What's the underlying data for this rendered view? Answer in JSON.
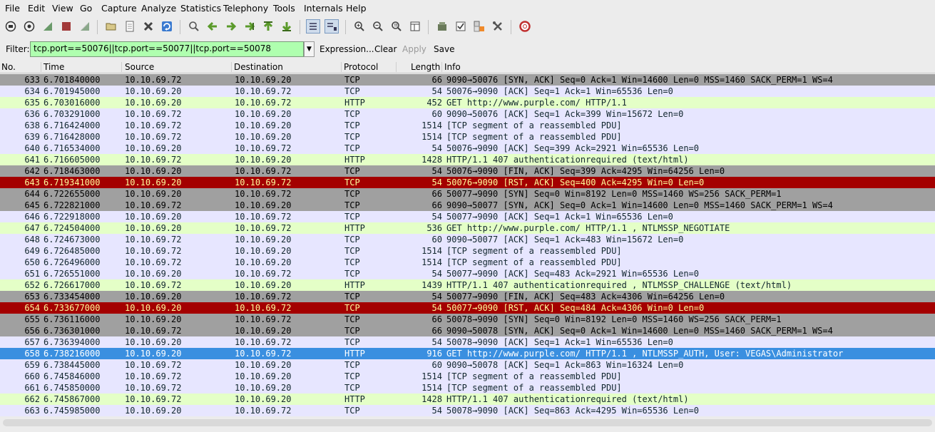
{
  "menu": [
    "File",
    "Edit",
    "View",
    "Go",
    "Capture",
    "Analyze",
    "Statistics",
    "Telephony",
    "Tools",
    "Internals",
    "Help"
  ],
  "toolbar_icons": [
    "interfaces-icon",
    "options-icon",
    "start-capture-icon",
    "stop-capture-icon",
    "restart-capture-icon",
    "open-file-icon",
    "save-file-icon",
    "close-file-icon",
    "reload-icon",
    "find-packet-icon",
    "go-back-icon",
    "go-forward-icon",
    "go-to-packet-icon",
    "go-first-icon",
    "go-last-icon",
    "colorize-icon",
    "autoscroll-icon",
    "zoom-in-icon",
    "zoom-out-icon",
    "normal-size-icon",
    "resize-columns-icon",
    "capture-filters-icon",
    "display-filters-icon",
    "coloring-rules-icon",
    "preferences-icon",
    "help-icon"
  ],
  "filter": {
    "label": "Filter:",
    "value": "tcp.port==50076||tcp.port==50077||tcp.port==50078",
    "expression": "Expression...",
    "clear": "Clear",
    "apply": "Apply",
    "save": "Save"
  },
  "columns": {
    "no": "No.",
    "time": "Time",
    "source": "Source",
    "destination": "Destination",
    "protocol": "Protocol",
    "length": "Length",
    "info": "Info"
  },
  "colors": {
    "tcp_syn": "#a0a0a0",
    "tcp": "#e7e6ff",
    "http": "#e4ffc7",
    "rst": "#a40000",
    "selected": "#3a8fe0"
  },
  "packets": [
    {
      "no": "633",
      "time": "6.701840000",
      "src": "10.10.69.72",
      "dst": "10.10.69.20",
      "proto": "TCP",
      "len": "66",
      "info": "9090→50076 [SYN, ACK] Seq=0 Ack=1 Win=14600 Len=0 MSS=1460 SACK_PERM=1 WS=4",
      "style": "syn"
    },
    {
      "no": "634",
      "time": "6.701945000",
      "src": "10.10.69.20",
      "dst": "10.10.69.72",
      "proto": "TCP",
      "len": "54",
      "info": "50076→9090 [ACK] Seq=1 Ack=1 Win=65536 Len=0",
      "style": "tcp"
    },
    {
      "no": "635",
      "time": "6.703016000",
      "src": "10.10.69.20",
      "dst": "10.10.69.72",
      "proto": "HTTP",
      "len": "452",
      "info": "GET http://www.purple.com/ HTTP/1.1",
      "style": "http"
    },
    {
      "no": "636",
      "time": "6.703291000",
      "src": "10.10.69.72",
      "dst": "10.10.69.20",
      "proto": "TCP",
      "len": "60",
      "info": "9090→50076 [ACK] Seq=1 Ack=399 Win=15672 Len=0",
      "style": "tcp"
    },
    {
      "no": "638",
      "time": "6.716424000",
      "src": "10.10.69.72",
      "dst": "10.10.69.20",
      "proto": "TCP",
      "len": "1514",
      "info": "[TCP segment of a reassembled PDU]",
      "style": "tcp"
    },
    {
      "no": "639",
      "time": "6.716428000",
      "src": "10.10.69.72",
      "dst": "10.10.69.20",
      "proto": "TCP",
      "len": "1514",
      "info": "[TCP segment of a reassembled PDU]",
      "style": "tcp"
    },
    {
      "no": "640",
      "time": "6.716534000",
      "src": "10.10.69.20",
      "dst": "10.10.69.72",
      "proto": "TCP",
      "len": "54",
      "info": "50076→9090 [ACK] Seq=399 Ack=2921 Win=65536 Len=0",
      "style": "tcp"
    },
    {
      "no": "641",
      "time": "6.716605000",
      "src": "10.10.69.72",
      "dst": "10.10.69.20",
      "proto": "HTTP",
      "len": "1428",
      "info": "HTTP/1.1 407 authenticationrequired  (text/html)",
      "style": "http"
    },
    {
      "no": "642",
      "time": "6.718463000",
      "src": "10.10.69.20",
      "dst": "10.10.69.72",
      "proto": "TCP",
      "len": "54",
      "info": "50076→9090 [FIN, ACK] Seq=399 Ack=4295 Win=64256 Len=0",
      "style": "syn"
    },
    {
      "no": "643",
      "time": "6.719341000",
      "src": "10.10.69.20",
      "dst": "10.10.69.72",
      "proto": "TCP",
      "len": "54",
      "info": "50076→9090 [RST, ACK] Seq=400 Ack=4295 Win=0 Len=0",
      "style": "rst"
    },
    {
      "no": "644",
      "time": "6.722655000",
      "src": "10.10.69.20",
      "dst": "10.10.69.72",
      "proto": "TCP",
      "len": "66",
      "info": "50077→9090 [SYN] Seq=0 Win=8192 Len=0 MSS=1460 WS=256 SACK_PERM=1",
      "style": "syn"
    },
    {
      "no": "645",
      "time": "6.722821000",
      "src": "10.10.69.72",
      "dst": "10.10.69.20",
      "proto": "TCP",
      "len": "66",
      "info": "9090→50077 [SYN, ACK] Seq=0 Ack=1 Win=14600 Len=0 MSS=1460 SACK_PERM=1 WS=4",
      "style": "syn"
    },
    {
      "no": "646",
      "time": "6.722918000",
      "src": "10.10.69.20",
      "dst": "10.10.69.72",
      "proto": "TCP",
      "len": "54",
      "info": "50077→9090 [ACK] Seq=1 Ack=1 Win=65536 Len=0",
      "style": "tcp"
    },
    {
      "no": "647",
      "time": "6.724504000",
      "src": "10.10.69.20",
      "dst": "10.10.69.72",
      "proto": "HTTP",
      "len": "536",
      "info": "GET http://www.purple.com/ HTTP/1.1 , NTLMSSP_NEGOTIATE",
      "style": "http"
    },
    {
      "no": "648",
      "time": "6.724673000",
      "src": "10.10.69.72",
      "dst": "10.10.69.20",
      "proto": "TCP",
      "len": "60",
      "info": "9090→50077 [ACK] Seq=1 Ack=483 Win=15672 Len=0",
      "style": "tcp"
    },
    {
      "no": "649",
      "time": "6.726485000",
      "src": "10.10.69.72",
      "dst": "10.10.69.20",
      "proto": "TCP",
      "len": "1514",
      "info": "[TCP segment of a reassembled PDU]",
      "style": "tcp"
    },
    {
      "no": "650",
      "time": "6.726496000",
      "src": "10.10.69.72",
      "dst": "10.10.69.20",
      "proto": "TCP",
      "len": "1514",
      "info": "[TCP segment of a reassembled PDU]",
      "style": "tcp"
    },
    {
      "no": "651",
      "time": "6.726551000",
      "src": "10.10.69.20",
      "dst": "10.10.69.72",
      "proto": "TCP",
      "len": "54",
      "info": "50077→9090 [ACK] Seq=483 Ack=2921 Win=65536 Len=0",
      "style": "tcp"
    },
    {
      "no": "652",
      "time": "6.726617000",
      "src": "10.10.69.72",
      "dst": "10.10.69.20",
      "proto": "HTTP",
      "len": "1439",
      "info": "HTTP/1.1 407 authenticationrequired , NTLMSSP_CHALLENGE (text/html)",
      "style": "http"
    },
    {
      "no": "653",
      "time": "6.733454000",
      "src": "10.10.69.20",
      "dst": "10.10.69.72",
      "proto": "TCP",
      "len": "54",
      "info": "50077→9090 [FIN, ACK] Seq=483 Ack=4306 Win=64256 Len=0",
      "style": "syn"
    },
    {
      "no": "654",
      "time": "6.733677000",
      "src": "10.10.69.20",
      "dst": "10.10.69.72",
      "proto": "TCP",
      "len": "54",
      "info": "50077→9090 [RST, ACK] Seq=484 Ack=4306 Win=0 Len=0",
      "style": "rst"
    },
    {
      "no": "655",
      "time": "6.736116000",
      "src": "10.10.69.20",
      "dst": "10.10.69.72",
      "proto": "TCP",
      "len": "66",
      "info": "50078→9090 [SYN] Seq=0 Win=8192 Len=0 MSS=1460 WS=256 SACK_PERM=1",
      "style": "syn"
    },
    {
      "no": "656",
      "time": "6.736301000",
      "src": "10.10.69.72",
      "dst": "10.10.69.20",
      "proto": "TCP",
      "len": "66",
      "info": "9090→50078 [SYN, ACK] Seq=0 Ack=1 Win=14600 Len=0 MSS=1460 SACK_PERM=1 WS=4",
      "style": "syn"
    },
    {
      "no": "657",
      "time": "6.736394000",
      "src": "10.10.69.20",
      "dst": "10.10.69.72",
      "proto": "TCP",
      "len": "54",
      "info": "50078→9090 [ACK] Seq=1 Ack=1 Win=65536 Len=0",
      "style": "tcp"
    },
    {
      "no": "658",
      "time": "6.738216000",
      "src": "10.10.69.20",
      "dst": "10.10.69.72",
      "proto": "HTTP",
      "len": "916",
      "info": "GET http://www.purple.com/ HTTP/1.1 , NTLMSSP_AUTH, User: VEGAS\\Administrator",
      "style": "selected"
    },
    {
      "no": "659",
      "time": "6.738445000",
      "src": "10.10.69.72",
      "dst": "10.10.69.20",
      "proto": "TCP",
      "len": "60",
      "info": "9090→50078 [ACK] Seq=1 Ack=863 Win=16324 Len=0",
      "style": "tcp"
    },
    {
      "no": "660",
      "time": "6.745846000",
      "src": "10.10.69.72",
      "dst": "10.10.69.20",
      "proto": "TCP",
      "len": "1514",
      "info": "[TCP segment of a reassembled PDU]",
      "style": "tcp"
    },
    {
      "no": "661",
      "time": "6.745850000",
      "src": "10.10.69.72",
      "dst": "10.10.69.20",
      "proto": "TCP",
      "len": "1514",
      "info": "[TCP segment of a reassembled PDU]",
      "style": "tcp"
    },
    {
      "no": "662",
      "time": "6.745867000",
      "src": "10.10.69.72",
      "dst": "10.10.69.20",
      "proto": "HTTP",
      "len": "1428",
      "info": "HTTP/1.1 407 authenticationrequired  (text/html)",
      "style": "http"
    },
    {
      "no": "663",
      "time": "6.745985000",
      "src": "10.10.69.20",
      "dst": "10.10.69.72",
      "proto": "TCP",
      "len": "54",
      "info": "50078→9090 [ACK] Seq=863 Ack=4295 Win=65536 Len=0",
      "style": "tcp"
    }
  ]
}
